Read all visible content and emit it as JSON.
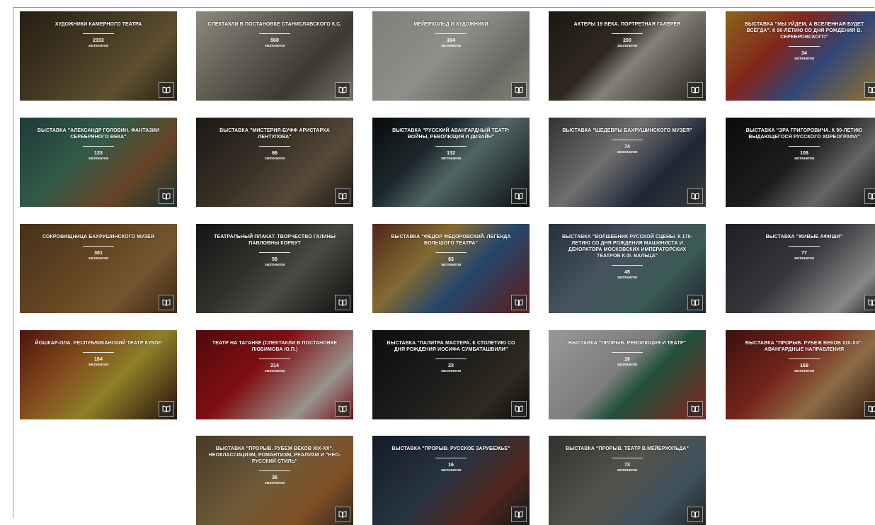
{
  "cards": [
    {
      "title": "Художники Камерного театра",
      "count": "2153",
      "unit": "экспонатов",
      "bg": "linear-gradient(135deg,#3a2e1d 0%,#6b5a36 45%,#8f7a47 70%,#40331f 100%)",
      "icon": "book-icon"
    },
    {
      "title": "Спектакли в постановке Станиславского К.С.",
      "count": "568",
      "unit": "экспонатов",
      "bg": "linear-gradient(135deg,#d7d1c0 0%,#8d887a 40%,#5d584c 70%,#b7af99 100%)",
      "icon": "book-icon"
    },
    {
      "title": "Мейерхольд и художники",
      "count": "304",
      "unit": "экспонатов",
      "bg": "linear-gradient(135deg,#bfc2b9 0%,#dad9cf 45%,#9fa296 75%,#c8c6ba 100%)",
      "icon": "book-icon"
    },
    {
      "title": "Актеры 19 века. Портретная галерея",
      "count": "200",
      "unit": "экспонатов",
      "bg": "linear-gradient(135deg,#2b241b 0%,#4a4031 40%,#c9c3b3 55%,#3b3326 100%)",
      "icon": "book-icon"
    },
    {
      "title": "Выставка \"Мы уйдем, а Вселенная будет всегда\". К 90-летию со дня рождения В. Серебровского\"",
      "count": "34",
      "unit": "экспонатов",
      "bg": "linear-gradient(135deg,#d19a2c 0%,#c53a2a 35%,#4a6bb4 60%,#e3b342 100%)",
      "icon": "book-icon"
    },
    {
      "title": "Выставка \"Александр Головин. Фантазии Серебряного века\"",
      "count": "133",
      "unit": "экспонатов",
      "bg": "linear-gradient(135deg,#2f5a56 0%,#4d8a6f 40%,#9a6a3a 70%,#2f4b4d 100%)",
      "icon": "book-icon"
    },
    {
      "title": "Выставка \"Мистерия-буфф Аристарха Лентулова\"",
      "count": "66",
      "unit": "экспонатов",
      "bg": "linear-gradient(135deg,#2a2520 0%,#5b4d3c 45%,#847058 70%,#2c2620 100%)",
      "icon": "book-icon"
    },
    {
      "title": "Выставка \"Русский авангардный театр: войны, революция и дизайн\"",
      "count": "132",
      "unit": "экспонатов",
      "bg": "linear-gradient(135deg,#0e1213 0%,#2c3f46 35%,#7c9a9a 55%,#101617 100%)",
      "icon": "book-icon"
    },
    {
      "title": "Выставка \"Шедевры Бахрушинского музея\"",
      "count": "74",
      "unit": "экспонатов",
      "bg": "linear-gradient(135deg,#4c4c4c 0%,#a9a9a6 40%,#2d3b55 70%,#5a5a58 100%)",
      "icon": "book-icon"
    },
    {
      "title": "Выставка \"Эра Григоровича. К 90-летию выдающегося русского хореографа\"",
      "count": "108",
      "unit": "экспонатов",
      "bg": "linear-gradient(135deg,#111111 0%,#2d2d2d 45%,#9b9b9b 70%,#1a1a1a 100%)",
      "icon": "book-icon"
    },
    {
      "title": "Сокровищница Бахрушинского музея",
      "count": "301",
      "unit": "экспонатов",
      "bg": "linear-gradient(135deg,#6b4a25 0%,#9a6c36 45%,#b08247 70%,#5a3c1f 100%)",
      "icon": "book-icon"
    },
    {
      "title": "Театральный плакат. Творчество Галины Павловны Корбут",
      "count": "59",
      "unit": "экспонатов",
      "bg": "linear-gradient(135deg,#202020 0%,#4d4d45 40%,#6e7065 60%,#1b1b1b 100%)",
      "icon": "book-icon"
    },
    {
      "title": "Выставка \"Федор Федоровский. Легенда Большого театра\"",
      "count": "83",
      "unit": "экспонатов",
      "bg": "linear-gradient(135deg,#7a3a2a 0%,#c7a34c 35%,#3a6aa3 60%,#8f2e2a 100%)",
      "icon": "book-icon"
    },
    {
      "title": "Выставка \"Волшебник русской сцены. К 170-летию со дня рождения машиниста и декоратора Московских императорских театров К.Ф. Вальца\"",
      "count": "45",
      "unit": "экспонатов",
      "bg": "linear-gradient(135deg,#3a4a5f 0%,#6b7d8f 40%,#5a8a82 70%,#2f3b4d 100%)",
      "icon": "book-icon"
    },
    {
      "title": "Выставка \"Живые афиши\"",
      "count": "77",
      "unit": "экспонатов",
      "bg": "linear-gradient(135deg,#302f36 0%,#55525c 45%,#cfcfcf 80%,#2a2930 100%)",
      "icon": "book-icon"
    },
    {
      "title": "Йошкар-Ола. Республиканский театр кукол",
      "count": "164",
      "unit": "экспонатов",
      "bg": "linear-gradient(135deg,#7a1f1a 0%,#c6752c 35%,#d7c23e 60%,#3a1a12 100%)",
      "icon": "book-icon"
    },
    {
      "title": "Театр на Таганке (спектакли в постановке Любимова Ю.П.)",
      "count": "214",
      "unit": "экспонатов",
      "bg": "linear-gradient(135deg,#7a0f12 0%,#c2181e 40%,#e9e0d8 75%,#b01519 100%)",
      "icon": "book-icon"
    },
    {
      "title": "Выставка \"Палитра мастера. К столетию со дня рождения Иосифа Сумбаташвили\"",
      "count": "23",
      "unit": "экспонатов",
      "bg": "linear-gradient(135deg,#151515 0%,#2b2b2b 45%,#4a4130 75%,#141414 100%)",
      "icon": "book-icon"
    },
    {
      "title": "Выставка \"Прорыв. Революция и театр\"",
      "count": "16",
      "unit": "экспонатов",
      "bg": "linear-gradient(135deg,#e8e8e6 0%,#bdbdbb 45%,#2f7a5a 60%,#c93a2a 100%)",
      "icon": "book-icon"
    },
    {
      "title": "Выставка \"Прорыв. Рубеж веков XIX-XX\". Авангардные направления",
      "count": "169",
      "unit": "экспонатов",
      "bg": "linear-gradient(135deg,#5a1a16 0%,#b23a2a 40%,#d9a66a 65%,#3a1a14 100%)",
      "icon": "book-icon"
    },
    {
      "title": "Выставка \"Прорыв. Рубеж веков XIX-XX\". Неоклассицизм, романтизм, реализм и \"Нео-русский стиль\"",
      "count": "36",
      "unit": "экспонатов",
      "bg": "linear-gradient(135deg,#6c5a3a 0%,#a88a55 45%,#c27a3a 75%,#4d3d26 100%)",
      "icon": "book-icon"
    },
    {
      "title": "Выставка \"Прорыв. Русское зарубежье\"",
      "count": "16",
      "unit": "экспонатов",
      "bg": "linear-gradient(135deg,#1e2b3a 0%,#3d4f65 45%,#7a3a2a 75%,#1a2430 100%)",
      "icon": "book-icon"
    },
    {
      "title": "Выставка \"Прорыв. Театр В.Мейерхольда\"",
      "count": "73",
      "unit": "экспонатов",
      "bg": "linear-gradient(135deg,#4b4b45 0%,#7f7d73 45%,#5d7c8f 75%,#3b3b36 100%)",
      "icon": "book-icon"
    }
  ]
}
